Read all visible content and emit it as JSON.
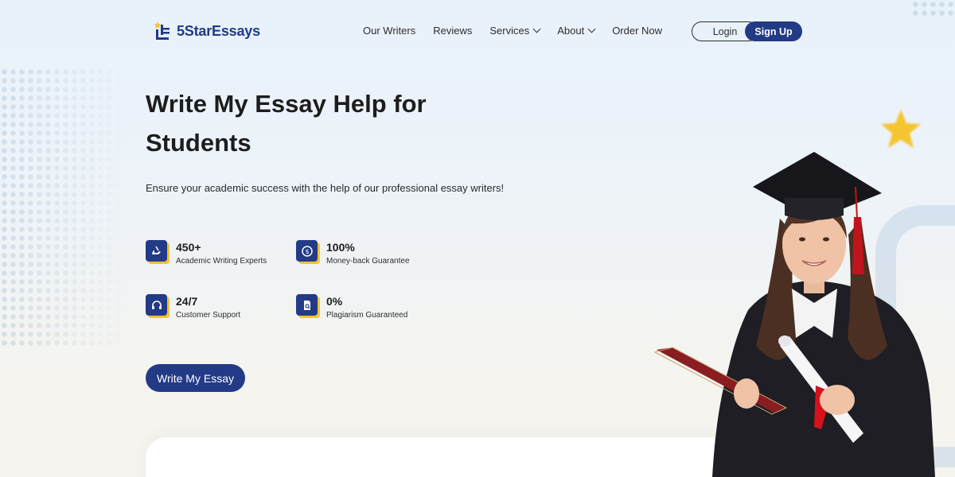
{
  "brand": {
    "name": "5StarEssays"
  },
  "nav": {
    "items": [
      {
        "label": "Our Writers",
        "has_dropdown": false
      },
      {
        "label": "Reviews",
        "has_dropdown": false
      },
      {
        "label": "Services",
        "has_dropdown": true
      },
      {
        "label": "About",
        "has_dropdown": true
      },
      {
        "label": "Order Now",
        "has_dropdown": false
      }
    ],
    "login_label": "Login",
    "signup_label": "Sign Up"
  },
  "hero": {
    "title_line1": "Write My Essay Help for",
    "title_line2": "Students",
    "subtitle": "Ensure your academic success with the help of our professional essay writers!",
    "cta_label": "Write My Essay"
  },
  "stats": [
    {
      "value": "450+",
      "label": "Academic Writing Experts",
      "icon": "writer-hand-icon"
    },
    {
      "value": "100%",
      "label": "Money-back Guarantee",
      "icon": "money-back-icon"
    },
    {
      "value": "24/7",
      "label": "Customer Support",
      "icon": "headset-icon"
    },
    {
      "value": "0%",
      "label": "Plagiarism Guaranteed",
      "icon": "document-search-icon"
    }
  ],
  "colors": {
    "brand_blue": "#233a86",
    "accent_yellow": "#f2c230",
    "text_dark": "#1d1d1d"
  }
}
